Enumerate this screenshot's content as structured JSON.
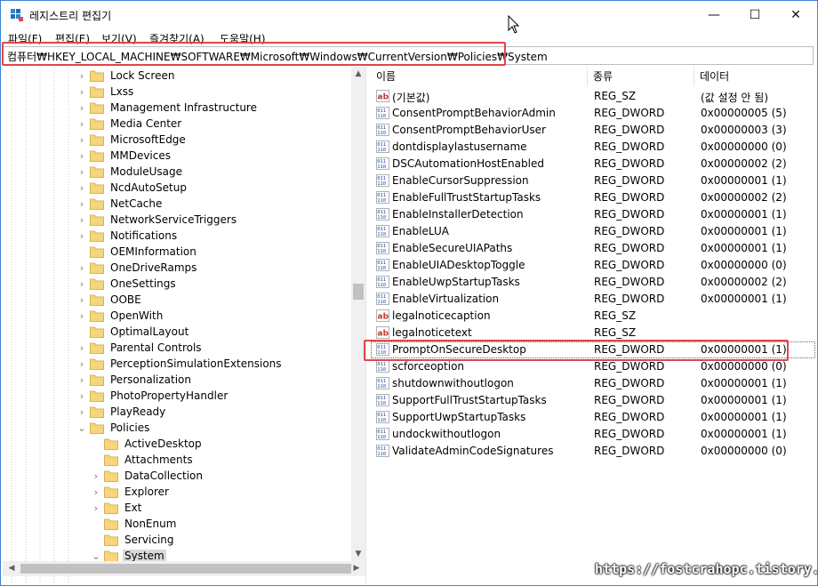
{
  "window": {
    "title": "레지스트리 편집기",
    "minimize": "—",
    "maximize": "☐",
    "close": "✕"
  },
  "menu": [
    "파일(F)",
    "편집(E)",
    "보기(V)",
    "즐겨찾기(A)",
    "도움말(H)"
  ],
  "address": "컴퓨터₩HKEY_LOCAL_MACHINE₩SOFTWARE₩Microsoft₩Windows₩CurrentVersion₩Policies₩System",
  "tree": {
    "items": [
      {
        "label": "Lock Screen",
        "level": 1,
        "expander": "›"
      },
      {
        "label": "Lxss",
        "level": 1,
        "expander": "›"
      },
      {
        "label": "Management Infrastructure",
        "level": 1,
        "expander": "›"
      },
      {
        "label": "Media Center",
        "level": 1,
        "expander": "›"
      },
      {
        "label": "MicrosoftEdge",
        "level": 1,
        "expander": "›"
      },
      {
        "label": "MMDevices",
        "level": 1,
        "expander": "›"
      },
      {
        "label": "ModuleUsage",
        "level": 1,
        "expander": "›"
      },
      {
        "label": "NcdAutoSetup",
        "level": 1,
        "expander": "›"
      },
      {
        "label": "NetCache",
        "level": 1,
        "expander": "›"
      },
      {
        "label": "NetworkServiceTriggers",
        "level": 1,
        "expander": "›"
      },
      {
        "label": "Notifications",
        "level": 1,
        "expander": "›"
      },
      {
        "label": "OEMInformation",
        "level": 1,
        "expander": ""
      },
      {
        "label": "OneDriveRamps",
        "level": 1,
        "expander": "›"
      },
      {
        "label": "OneSettings",
        "level": 1,
        "expander": "›"
      },
      {
        "label": "OOBE",
        "level": 1,
        "expander": "›"
      },
      {
        "label": "OpenWith",
        "level": 1,
        "expander": "›"
      },
      {
        "label": "OptimalLayout",
        "level": 1,
        "expander": ""
      },
      {
        "label": "Parental Controls",
        "level": 1,
        "expander": "›"
      },
      {
        "label": "PerceptionSimulationExtensions",
        "level": 1,
        "expander": "›"
      },
      {
        "label": "Personalization",
        "level": 1,
        "expander": "›"
      },
      {
        "label": "PhotoPropertyHandler",
        "level": 1,
        "expander": "›"
      },
      {
        "label": "PlayReady",
        "level": 1,
        "expander": "›"
      },
      {
        "label": "Policies",
        "level": 1,
        "expander": "⌄"
      },
      {
        "label": "ActiveDesktop",
        "level": 2,
        "expander": ""
      },
      {
        "label": "Attachments",
        "level": 2,
        "expander": ""
      },
      {
        "label": "DataCollection",
        "level": 2,
        "expander": "›"
      },
      {
        "label": "Explorer",
        "level": 2,
        "expander": "›"
      },
      {
        "label": "Ext",
        "level": 2,
        "expander": "›"
      },
      {
        "label": "NonEnum",
        "level": 2,
        "expander": ""
      },
      {
        "label": "Servicing",
        "level": 2,
        "expander": ""
      },
      {
        "label": "System",
        "level": 2,
        "expander": "⌄",
        "selected": true
      }
    ]
  },
  "list": {
    "columns": [
      "이름",
      "종류",
      "데이터"
    ],
    "rows": [
      {
        "icon": "string-value-icon",
        "name": "(기본값)",
        "type": "REG_SZ",
        "data": "(값 설정 안 됨)"
      },
      {
        "icon": "binary-value-icon",
        "name": "ConsentPromptBehaviorAdmin",
        "type": "REG_DWORD",
        "data": "0x00000005 (5)"
      },
      {
        "icon": "binary-value-icon",
        "name": "ConsentPromptBehaviorUser",
        "type": "REG_DWORD",
        "data": "0x00000003 (3)"
      },
      {
        "icon": "binary-value-icon",
        "name": "dontdisplaylastusername",
        "type": "REG_DWORD",
        "data": "0x00000000 (0)"
      },
      {
        "icon": "binary-value-icon",
        "name": "DSCAutomationHostEnabled",
        "type": "REG_DWORD",
        "data": "0x00000002 (2)"
      },
      {
        "icon": "binary-value-icon",
        "name": "EnableCursorSuppression",
        "type": "REG_DWORD",
        "data": "0x00000001 (1)"
      },
      {
        "icon": "binary-value-icon",
        "name": "EnableFullTrustStartupTasks",
        "type": "REG_DWORD",
        "data": "0x00000002 (2)"
      },
      {
        "icon": "binary-value-icon",
        "name": "EnableInstallerDetection",
        "type": "REG_DWORD",
        "data": "0x00000001 (1)"
      },
      {
        "icon": "binary-value-icon",
        "name": "EnableLUA",
        "type": "REG_DWORD",
        "data": "0x00000001 (1)"
      },
      {
        "icon": "binary-value-icon",
        "name": "EnableSecureUIAPaths",
        "type": "REG_DWORD",
        "data": "0x00000001 (1)"
      },
      {
        "icon": "binary-value-icon",
        "name": "EnableUIADesktopToggle",
        "type": "REG_DWORD",
        "data": "0x00000000 (0)"
      },
      {
        "icon": "binary-value-icon",
        "name": "EnableUwpStartupTasks",
        "type": "REG_DWORD",
        "data": "0x00000002 (2)"
      },
      {
        "icon": "binary-value-icon",
        "name": "EnableVirtualization",
        "type": "REG_DWORD",
        "data": "0x00000001 (1)"
      },
      {
        "icon": "string-value-icon",
        "name": "legalnoticecaption",
        "type": "REG_SZ",
        "data": ""
      },
      {
        "icon": "string-value-icon",
        "name": "legalnoticetext",
        "type": "REG_SZ",
        "data": ""
      },
      {
        "icon": "binary-value-icon",
        "name": "PromptOnSecureDesktop",
        "type": "REG_DWORD",
        "data": "0x00000001 (1)",
        "selected": true
      },
      {
        "icon": "binary-value-icon",
        "name": "scforceoption",
        "type": "REG_DWORD",
        "data": "0x00000000 (0)"
      },
      {
        "icon": "binary-value-icon",
        "name": "shutdownwithoutlogon",
        "type": "REG_DWORD",
        "data": "0x00000001 (1)"
      },
      {
        "icon": "binary-value-icon",
        "name": "SupportFullTrustStartupTasks",
        "type": "REG_DWORD",
        "data": "0x00000001 (1)"
      },
      {
        "icon": "binary-value-icon",
        "name": "SupportUwpStartupTasks",
        "type": "REG_DWORD",
        "data": "0x00000001 (1)"
      },
      {
        "icon": "binary-value-icon",
        "name": "undockwithoutlogon",
        "type": "REG_DWORD",
        "data": "0x00000001 (1)"
      },
      {
        "icon": "binary-value-icon",
        "name": "ValidateAdminCodeSignatures",
        "type": "REG_DWORD",
        "data": "0x00000000 (0)"
      }
    ]
  },
  "watermark": "https://fostcrahopc.tistory.com",
  "colors": {
    "highlight": "#e2454a",
    "folder": "#f7d57a",
    "selection": "#d9d9d9"
  }
}
